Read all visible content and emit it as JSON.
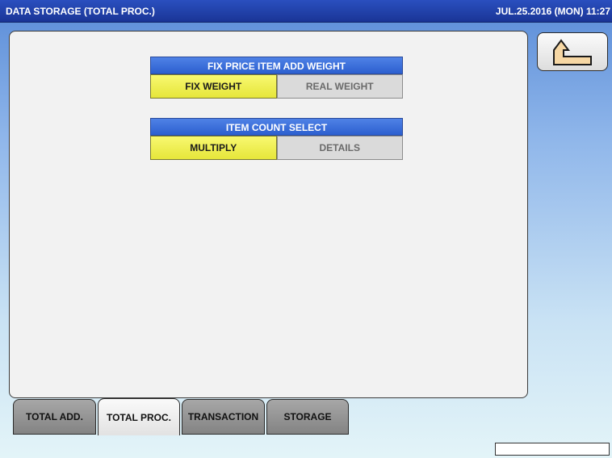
{
  "header": {
    "title": "DATA STORAGE (TOTAL PROC.)",
    "datetime": "JUL.25.2016 (MON)  11:27"
  },
  "settings": [
    {
      "label": "FIX PRICE ITEM ADD WEIGHT",
      "options": [
        "FIX WEIGHT",
        "REAL WEIGHT"
      ],
      "selected": "FIX WEIGHT"
    },
    {
      "label": "ITEM COUNT SELECT",
      "options": [
        "MULTIPLY",
        "DETAILS"
      ],
      "selected": "MULTIPLY"
    }
  ],
  "back_button": {
    "icon": "return-arrow-icon"
  },
  "tabs": [
    {
      "label": "TOTAL ADD.",
      "active": false
    },
    {
      "label": "TOTAL PROC.",
      "active": true
    },
    {
      "label": "TRANSACTION",
      "active": false
    },
    {
      "label": "STORAGE",
      "active": false
    }
  ],
  "status_box": {
    "value": ""
  },
  "colors": {
    "title_bar": "#1f3fa8",
    "selected_option": "#eeee4a",
    "group_header": "#3a6fdc",
    "unselected_option": "#dadada"
  }
}
